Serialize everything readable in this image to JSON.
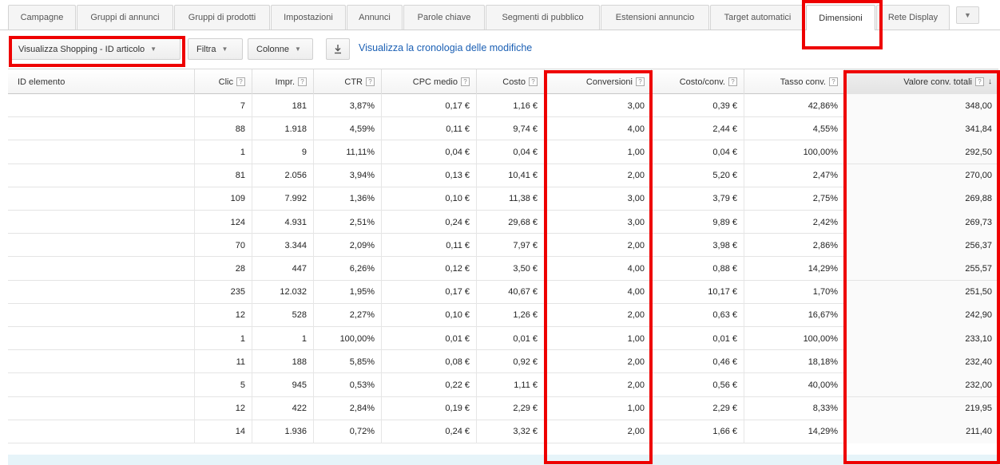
{
  "tabs": [
    {
      "label": "Campagne"
    },
    {
      "label": "Gruppi di annunci"
    },
    {
      "label": "Gruppi di prodotti"
    },
    {
      "label": "Impostazioni"
    },
    {
      "label": "Annunci"
    },
    {
      "label": "Parole chiave"
    },
    {
      "label": "Segmenti di pubblico"
    },
    {
      "label": "Estensioni annuncio"
    },
    {
      "label": "Target automatici"
    },
    {
      "label": "Dimensioni"
    },
    {
      "label": "Rete Display"
    },
    {
      "label": "▼"
    }
  ],
  "toolbar": {
    "view_label": "Visualizza Shopping - ID articolo",
    "filter_label": "Filtra",
    "columns_label": "Colonne",
    "history_link": "Visualizza la cronologia delle modifiche"
  },
  "table": {
    "help_mark": "?",
    "headers": [
      "ID elemento",
      "Clic",
      "Impr.",
      "CTR",
      "CPC medio",
      "Costo",
      "Conversioni",
      "Costo/conv.",
      "Tasso conv.",
      "Valore conv. totali"
    ],
    "rows": [
      [
        "",
        "7",
        "181",
        "3,87%",
        "0,17 €",
        "1,16 €",
        "3,00",
        "0,39 €",
        "42,86%",
        "348,00"
      ],
      [
        "",
        "88",
        "1.918",
        "4,59%",
        "0,11 €",
        "9,74 €",
        "4,00",
        "2,44 €",
        "4,55%",
        "341,84"
      ],
      [
        "",
        "1",
        "9",
        "11,11%",
        "0,04 €",
        "0,04 €",
        "1,00",
        "0,04 €",
        "100,00%",
        "292,50"
      ],
      [
        "",
        "81",
        "2.056",
        "3,94%",
        "0,13 €",
        "10,41 €",
        "2,00",
        "5,20 €",
        "2,47%",
        "270,00"
      ],
      [
        "",
        "109",
        "7.992",
        "1,36%",
        "0,10 €",
        "11,38 €",
        "3,00",
        "3,79 €",
        "2,75%",
        "269,88"
      ],
      [
        "",
        "124",
        "4.931",
        "2,51%",
        "0,24 €",
        "29,68 €",
        "3,00",
        "9,89 €",
        "2,42%",
        "269,73"
      ],
      [
        "",
        "70",
        "3.344",
        "2,09%",
        "0,11 €",
        "7,97 €",
        "2,00",
        "3,98 €",
        "2,86%",
        "256,37"
      ],
      [
        "",
        "28",
        "447",
        "6,26%",
        "0,12 €",
        "3,50 €",
        "4,00",
        "0,88 €",
        "14,29%",
        "255,57"
      ],
      [
        "",
        "235",
        "12.032",
        "1,95%",
        "0,17 €",
        "40,67 €",
        "4,00",
        "10,17 €",
        "1,70%",
        "251,50"
      ],
      [
        "",
        "12",
        "528",
        "2,27%",
        "0,10 €",
        "1,26 €",
        "2,00",
        "0,63 €",
        "16,67%",
        "242,90"
      ],
      [
        "",
        "1",
        "1",
        "100,00%",
        "0,01 €",
        "0,01 €",
        "1,00",
        "0,01 €",
        "100,00%",
        "233,10"
      ],
      [
        "",
        "11",
        "188",
        "5,85%",
        "0,08 €",
        "0,92 €",
        "2,00",
        "0,46 €",
        "18,18%",
        "232,40"
      ],
      [
        "",
        "5",
        "945",
        "0,53%",
        "0,22 €",
        "1,11 €",
        "2,00",
        "0,56 €",
        "40,00%",
        "232,00"
      ],
      [
        "",
        "12",
        "422",
        "2,84%",
        "0,19 €",
        "2,29 €",
        "1,00",
        "2,29 €",
        "8,33%",
        "219,95"
      ],
      [
        "",
        "14",
        "1.936",
        "0,72%",
        "0,24 €",
        "3,32 €",
        "2,00",
        "1,66 €",
        "14,29%",
        "211,40"
      ]
    ]
  },
  "colors": {
    "highlight": "#ee0000",
    "link": "#1a5fb4"
  }
}
